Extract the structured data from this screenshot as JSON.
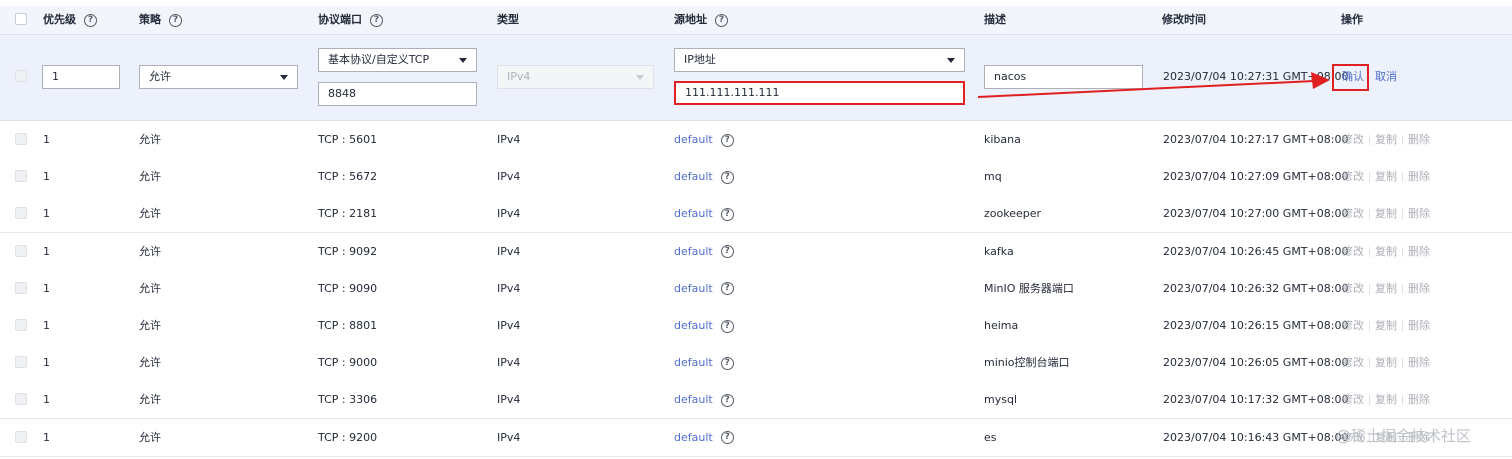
{
  "header": {
    "priority": "优先级",
    "policy": "策略",
    "protocol_port": "协议端口",
    "type": "类型",
    "source": "源地址",
    "description": "描述",
    "modified": "修改时间",
    "actions": "操作"
  },
  "edit_row": {
    "priority_value": "1",
    "policy_value": "允许",
    "protocol_value": "基本协议/自定义TCP",
    "port_value": "8848",
    "type_value": "IPv4",
    "source_type_value": "IP地址",
    "source_ip_value": "111.111.111.111",
    "description_value": "nacos",
    "modified": "2023/07/04 10:27:31 GMT+08:00",
    "confirm_label": "确认",
    "cancel_label": "取消"
  },
  "rules": [
    {
      "priority": "1",
      "policy": "允许",
      "port": "TCP : 5601",
      "type": "IPv4",
      "source": "default",
      "description": "kibana",
      "modified": "2023/07/04 10:27:17 GMT+08:00"
    },
    {
      "priority": "1",
      "policy": "允许",
      "port": "TCP : 5672",
      "type": "IPv4",
      "source": "default",
      "description": "mq",
      "modified": "2023/07/04 10:27:09 GMT+08:00"
    },
    {
      "priority": "1",
      "policy": "允许",
      "port": "TCP : 2181",
      "type": "IPv4",
      "source": "default",
      "description": "zookeeper",
      "modified": "2023/07/04 10:27:00 GMT+08:00"
    },
    {
      "priority": "1",
      "policy": "允许",
      "port": "TCP : 9092",
      "type": "IPv4",
      "source": "default",
      "description": "kafka",
      "modified": "2023/07/04 10:26:45 GMT+08:00"
    },
    {
      "priority": "1",
      "policy": "允许",
      "port": "TCP : 9090",
      "type": "IPv4",
      "source": "default",
      "description": "MinIO 服务器端口",
      "modified": "2023/07/04 10:26:32 GMT+08:00"
    },
    {
      "priority": "1",
      "policy": "允许",
      "port": "TCP : 8801",
      "type": "IPv4",
      "source": "default",
      "description": "heima",
      "modified": "2023/07/04 10:26:15 GMT+08:00"
    },
    {
      "priority": "1",
      "policy": "允许",
      "port": "TCP : 9000",
      "type": "IPv4",
      "source": "default",
      "description": "minio控制台端口",
      "modified": "2023/07/04 10:26:05 GMT+08:00"
    },
    {
      "priority": "1",
      "policy": "允许",
      "port": "TCP : 3306",
      "type": "IPv4",
      "source": "default",
      "description": "mysql",
      "modified": "2023/07/04 10:17:32 GMT+08:00"
    },
    {
      "priority": "1",
      "policy": "允许",
      "port": "TCP : 9200",
      "type": "IPv4",
      "source": "default",
      "description": "es",
      "modified": "2023/07/04 10:16:43 GMT+08:00"
    }
  ],
  "row_actions": {
    "edit": "修改",
    "copy": "复制",
    "delete": "删除"
  },
  "help_glyph": "?",
  "watermark": "@稀土掘金技术社区",
  "colors": {
    "link": "#526ecc",
    "highlight": "#e02020",
    "header_bg": "#f2f5fc",
    "edit_bg": "#edf1fb"
  }
}
